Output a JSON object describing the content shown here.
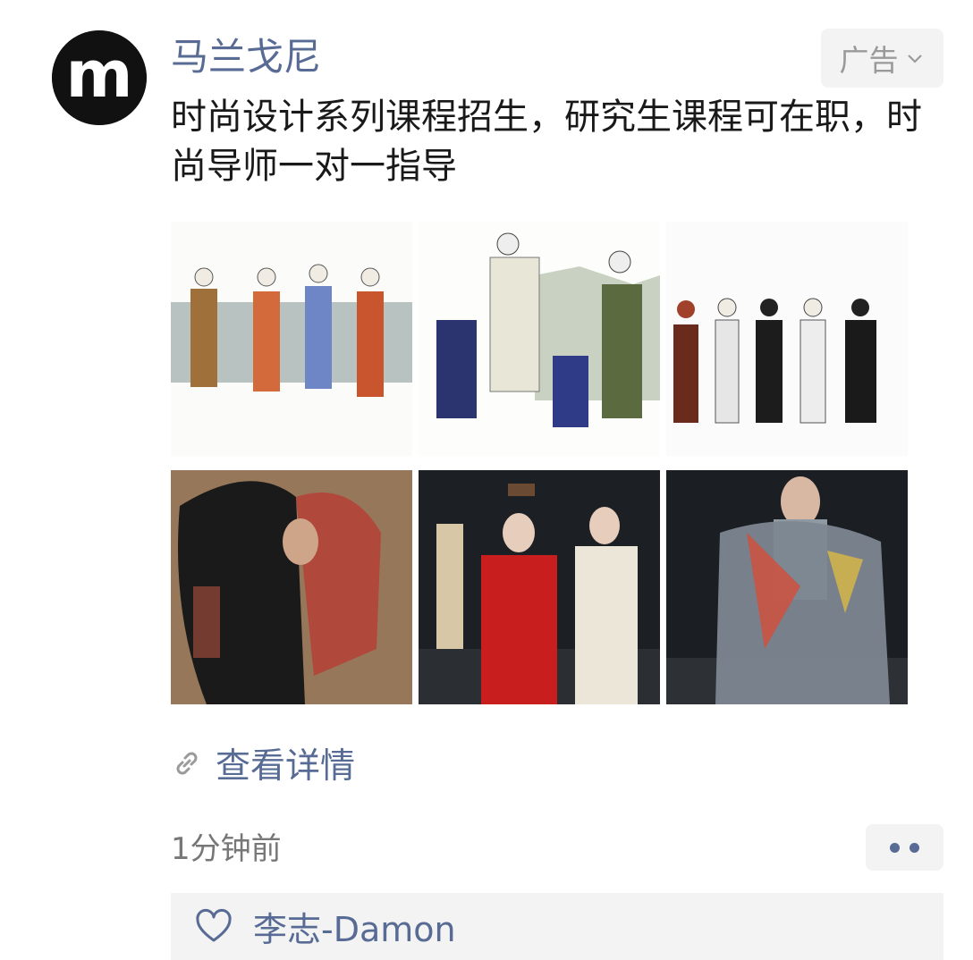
{
  "post": {
    "author": "马兰戈尼",
    "ad_label": "广告",
    "text": "时尚设计系列课程招生，研究生课程可在职，时尚导师一对一指导",
    "link_label": "查看详情",
    "time": "1分钟前"
  },
  "likes": {
    "names": "李志-Damon"
  },
  "colors": {
    "link_blue": "#576b95",
    "text": "#191919",
    "muted": "#777777",
    "panel_bg": "#f3f3f3"
  },
  "icons": {
    "ad_menu": "chevron-down-icon",
    "link": "link-icon",
    "like": "heart-icon",
    "more": "more-dots-icon"
  },
  "photos": [
    {
      "name": "fashion-sketch-lineup"
    },
    {
      "name": "fashion-sketch-collage"
    },
    {
      "name": "fashion-sketch-figures"
    },
    {
      "name": "runway-sequin-coat"
    },
    {
      "name": "runway-red-outfit"
    },
    {
      "name": "runway-metallic-top"
    }
  ]
}
